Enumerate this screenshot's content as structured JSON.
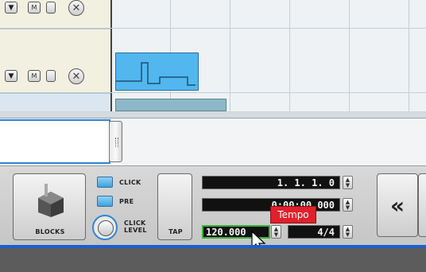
{
  "tracks": [
    {
      "mute_label": "M"
    },
    {
      "mute_label": "M"
    }
  ],
  "transport": {
    "blocks_label": "BLOCKS",
    "click_label": "CLICK",
    "pre_label": "PRE",
    "click_level_line1": "CLICK",
    "click_level_line2": "LEVEL",
    "tap_label": "TAP",
    "position": "1. 1. 1.   0",
    "time": "0:00:00.000",
    "tempo": "120.000",
    "signature": "4/4",
    "rewind_label": "«"
  },
  "tooltip": {
    "text": "Tempo"
  },
  "colors": {
    "clip": "#52b7ee",
    "accent": "#2f86d6",
    "tooltip": "#e0202a"
  }
}
